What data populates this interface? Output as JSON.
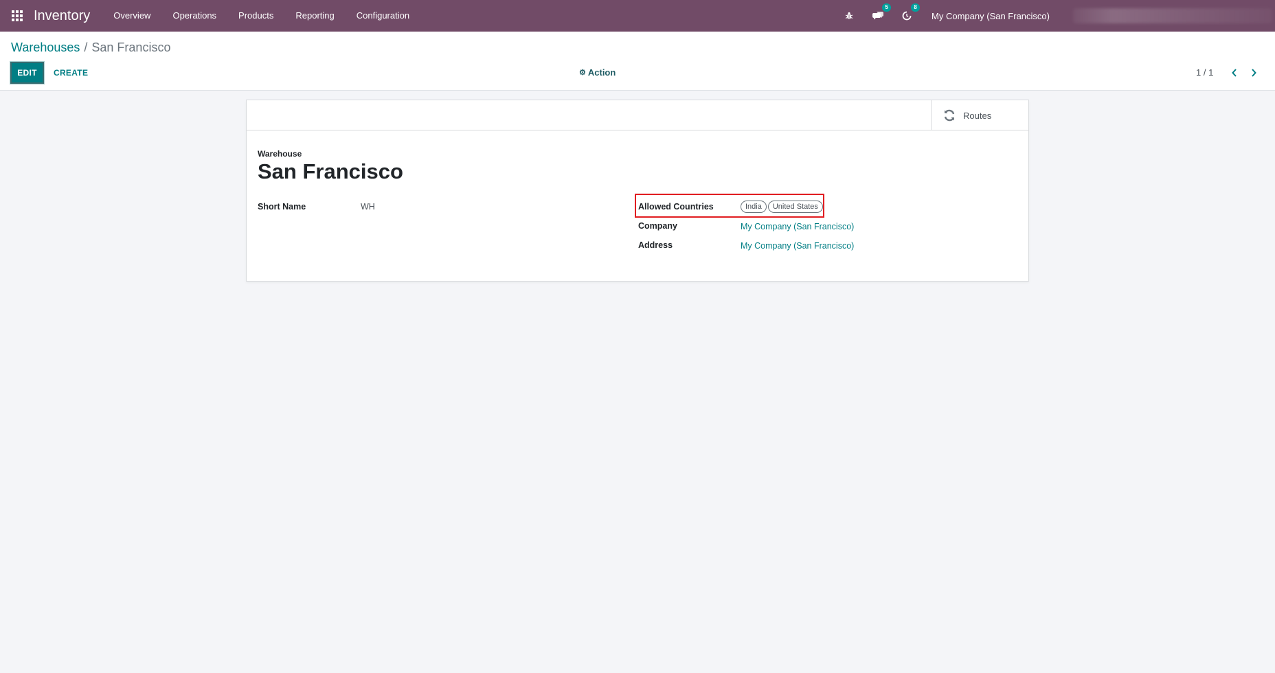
{
  "app": {
    "name": "Inventory",
    "menu": [
      "Overview",
      "Operations",
      "Products",
      "Reporting",
      "Configuration"
    ],
    "messages_count": "5",
    "activities_count": "8",
    "company": "My Company (San Francisco)"
  },
  "breadcrumb": {
    "parent": "Warehouses",
    "separator": "/",
    "current": "San Francisco"
  },
  "toolbar": {
    "edit_label": "EDIT",
    "create_label": "CREATE",
    "action_label": "Action",
    "pager": "1 / 1"
  },
  "form": {
    "routes_label": "Routes",
    "record_type": "Warehouse",
    "record_name": "San Francisco",
    "short_name_label": "Short Name",
    "short_name_value": "WH",
    "allowed_countries_label": "Allowed Countries",
    "allowed_countries": [
      "India",
      "United States"
    ],
    "company_label": "Company",
    "company_value": "My Company (San Francisco)",
    "address_label": "Address",
    "address_value": "My Company (San Francisco)"
  },
  "colors": {
    "navbar": "#714b67",
    "primary": "#017e84",
    "highlight": "#e11d21",
    "badge": "#00a09d"
  }
}
